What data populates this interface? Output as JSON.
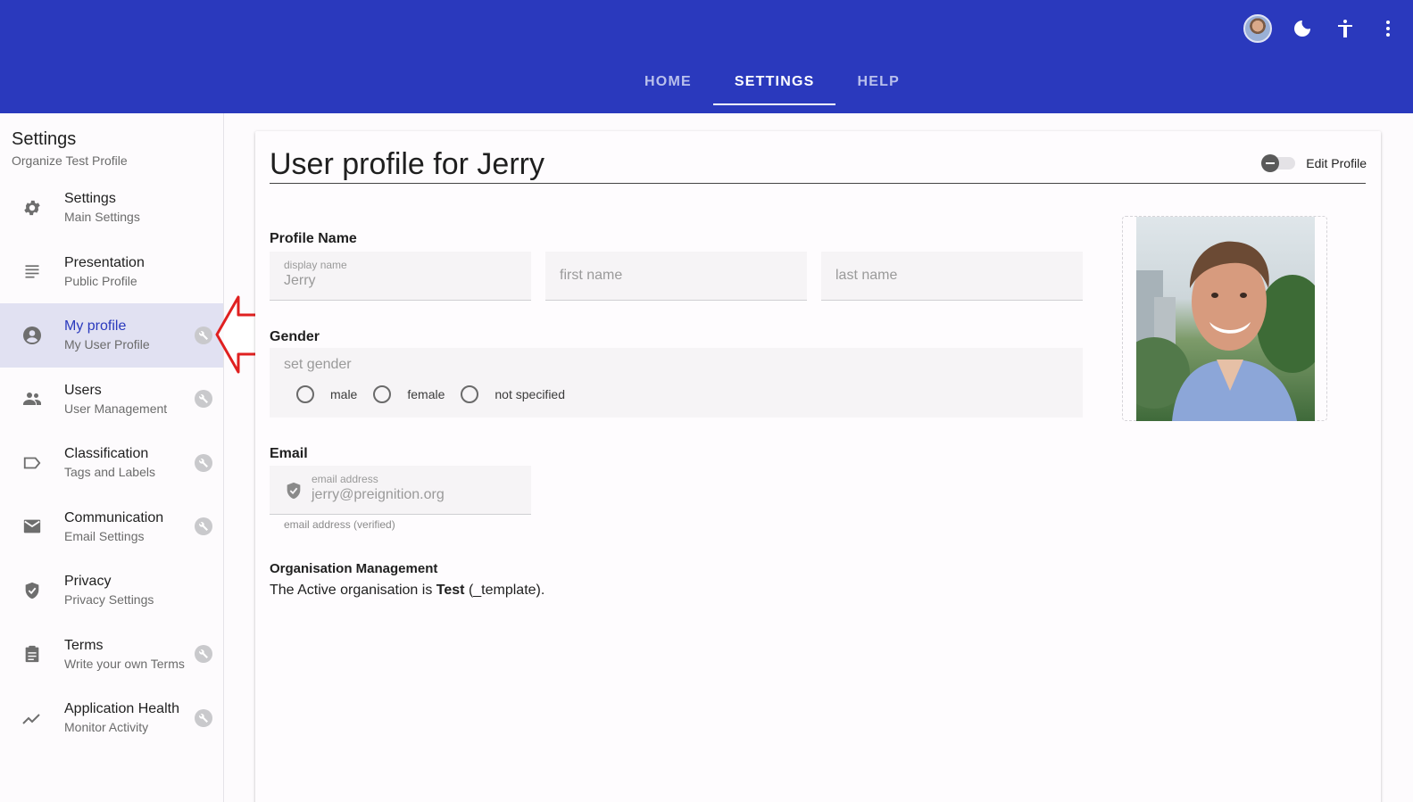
{
  "header": {
    "tabs": [
      {
        "label": "HOME",
        "active": false
      },
      {
        "label": "SETTINGS",
        "active": true
      },
      {
        "label": "HELP",
        "active": false
      }
    ],
    "icons": [
      "user-avatar",
      "dark-mode-icon",
      "accessibility-icon",
      "more-vert-icon"
    ]
  },
  "sidebar": {
    "title": "Settings",
    "subtitle": "Organize Test Profile",
    "items": [
      {
        "label": "Settings",
        "sub": "Main Settings",
        "icon": "gear-icon",
        "admin": false,
        "active": false
      },
      {
        "label": "Presentation",
        "sub": "Public Profile",
        "icon": "text-lines-icon",
        "admin": false,
        "active": false
      },
      {
        "label": "My profile",
        "sub": "My User Profile",
        "icon": "account-circle-icon",
        "admin": true,
        "active": true
      },
      {
        "label": "Users",
        "sub": "User Management",
        "icon": "people-icon",
        "admin": true,
        "active": false
      },
      {
        "label": "Classification",
        "sub": "Tags and Labels",
        "icon": "label-icon",
        "admin": true,
        "active": false
      },
      {
        "label": "Communication",
        "sub": "Email Settings",
        "icon": "mail-icon",
        "admin": true,
        "active": false
      },
      {
        "label": "Privacy",
        "sub": "Privacy Settings",
        "icon": "shield-icon",
        "admin": false,
        "active": false
      },
      {
        "label": "Terms",
        "sub": "Write your own Terms",
        "icon": "clipboard-icon",
        "admin": true,
        "active": false
      },
      {
        "label": "Application Health",
        "sub": "Monitor Activity",
        "icon": "trend-icon",
        "admin": true,
        "active": false
      }
    ]
  },
  "main": {
    "title": "User profile for Jerry",
    "edit_toggle_label": "Edit Profile",
    "profile_name": {
      "label": "Profile Name",
      "display_name_label": "display name",
      "display_name_value": "Jerry",
      "first_name_placeholder": "first name",
      "last_name_placeholder": "last name"
    },
    "gender": {
      "label": "Gender",
      "placeholder": "set gender",
      "options": [
        "male",
        "female",
        "not specified"
      ]
    },
    "email": {
      "label": "Email",
      "field_label": "email address",
      "value": "jerry@preignition.org",
      "hint": "email address (verified)"
    },
    "organisation": {
      "label": "Organisation Management",
      "prefix": "The Active organisation is",
      "org_name": "Test",
      "suffix": "(_template)."
    }
  },
  "colors": {
    "header_bg": "#2a39bd",
    "active_nav_bg": "#e1e1f2",
    "active_nav_text": "#2a39bd",
    "annotation_arrow": "#e02020"
  }
}
